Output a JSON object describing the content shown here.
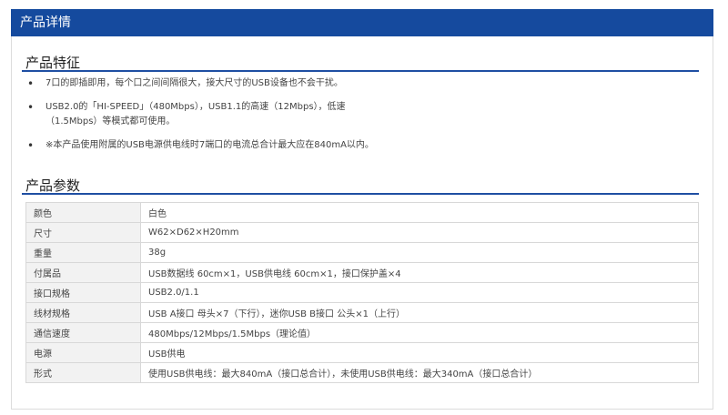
{
  "header": {
    "title": "产品详情"
  },
  "features_section": {
    "title": "产品特征",
    "items": [
      "7口的即插即用，每个口之间间隔很大，接大尺寸的USB设备也不会干扰。",
      "USB2.0的「HI-SPEED」（480Mbps），USB1.1的高速（12Mbps），低速（1.5Mbps）等模式都可使用。",
      "※本产品使用附属的USB电源供电线时7端口的电流总合计最大应在840mA以内。"
    ]
  },
  "specs_section": {
    "title": "产品参数",
    "rows": [
      {
        "key": "颜色",
        "value": "白色"
      },
      {
        "key": "尺寸",
        "value": "W62×D62×H20mm"
      },
      {
        "key": "重量",
        "value": "38g"
      },
      {
        "key": "付属品",
        "value": "USB数据线 60cm×1，USB供电线 60cm×1，接口保护盖×4"
      },
      {
        "key": "接口规格",
        "value": "USB2.0/1.1"
      },
      {
        "key": "线材规格",
        "value": "USB A接口 母头×7（下行），迷你USB B接口 公头×1（上行）"
      },
      {
        "key": "通信速度",
        "value": "480Mbps/12Mbps/1.5Mbps（理论值）"
      },
      {
        "key": "电源",
        "value": "USB供电"
      },
      {
        "key": "形式",
        "value": "使用USB供电线：最大840mA（接口总合计），未使用USB供电线：最大340mA（接口总合计）"
      }
    ]
  },
  "colors": {
    "header_bg": "#154a9e",
    "rule": "#1f4fa3"
  }
}
